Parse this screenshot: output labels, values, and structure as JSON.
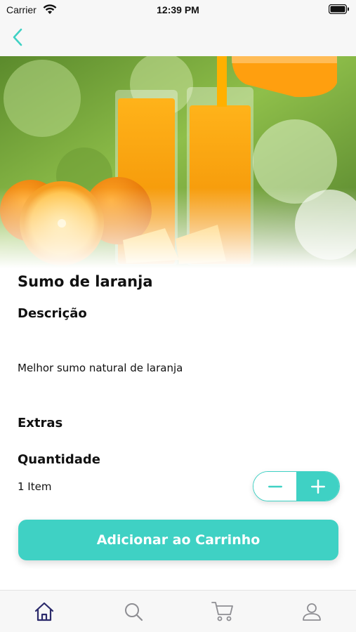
{
  "status_bar": {
    "carrier": "Carrier",
    "time": "12:39 PM"
  },
  "product": {
    "title": "Sumo de laranja",
    "description_heading": "Descrição",
    "description": "Melhor sumo natural de laranja",
    "extras_heading": "Extras",
    "quantity_heading": "Quantidade",
    "quantity_text": "1 Item",
    "quantity_value": 1
  },
  "actions": {
    "add_to_cart": "Adicionar ao Carrinho"
  },
  "tabs": [
    {
      "name": "home",
      "icon": "home-icon",
      "active": true
    },
    {
      "name": "search",
      "icon": "search-icon",
      "active": false
    },
    {
      "name": "cart",
      "icon": "cart-icon",
      "active": false
    },
    {
      "name": "profile",
      "icon": "user-icon",
      "active": false
    }
  ],
  "colors": {
    "accent": "#3fd1c4",
    "active_tab": "#2b2a6b",
    "inactive_tab": "#8e8e93"
  }
}
